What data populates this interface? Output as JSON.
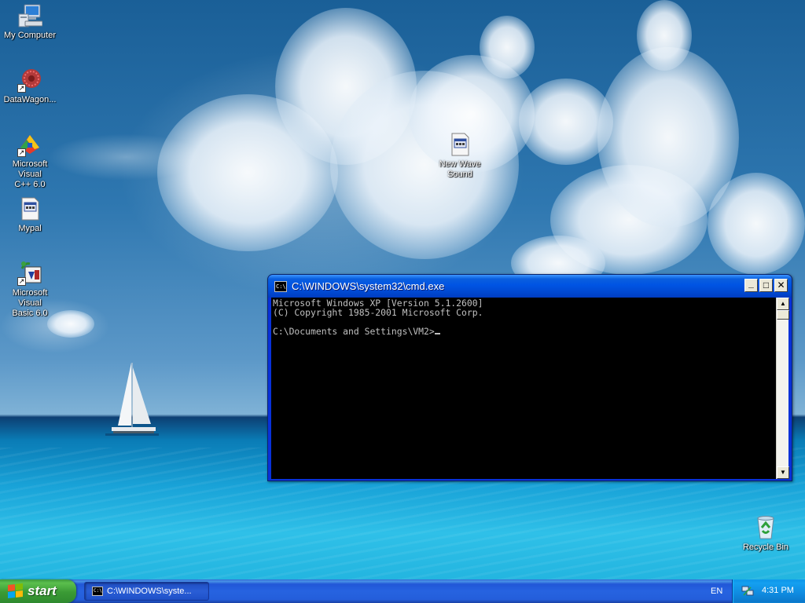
{
  "desktop": {
    "icons": [
      {
        "label": "My Computer",
        "icon": "my-computer-icon"
      },
      {
        "label": "DataWagon...",
        "icon": "datawagon-icon"
      },
      {
        "label": "Microsoft Visual\nC++ 6.0",
        "icon": "visual-cpp-icon"
      },
      {
        "label": "Mypal",
        "icon": "mypal-icon"
      },
      {
        "label": "Microsoft Visual\nBasic 6.0",
        "icon": "visual-basic-icon"
      },
      {
        "label": "New Wave\nSound",
        "icon": "wave-sound-file-icon"
      },
      {
        "label": "Recycle Bin",
        "icon": "recycle-bin-icon"
      }
    ]
  },
  "cmd_window": {
    "title": "C:\\WINDOWS\\system32\\cmd.exe",
    "icon_text": "C:\\",
    "lines": [
      "Microsoft Windows XP [Version 5.1.2600]",
      "(C) Copyright 1985-2001 Microsoft Corp.",
      "",
      "C:\\Documents and Settings\\VM2>"
    ],
    "buttons": {
      "minimize": "_",
      "maximize": "□",
      "close": "✕"
    }
  },
  "taskbar": {
    "start_label": "start",
    "tasks": [
      {
        "label": "C:\\WINDOWS\\syste...",
        "icon_text": "C:\\"
      }
    ],
    "language": "EN",
    "clock": "4:31 PM"
  },
  "colors": {
    "taskbar_blue": "#245edb",
    "start_green": "#3a9a35",
    "title_blue": "#0054e3",
    "console_bg": "#000000",
    "console_fg": "#c0c0c0"
  }
}
